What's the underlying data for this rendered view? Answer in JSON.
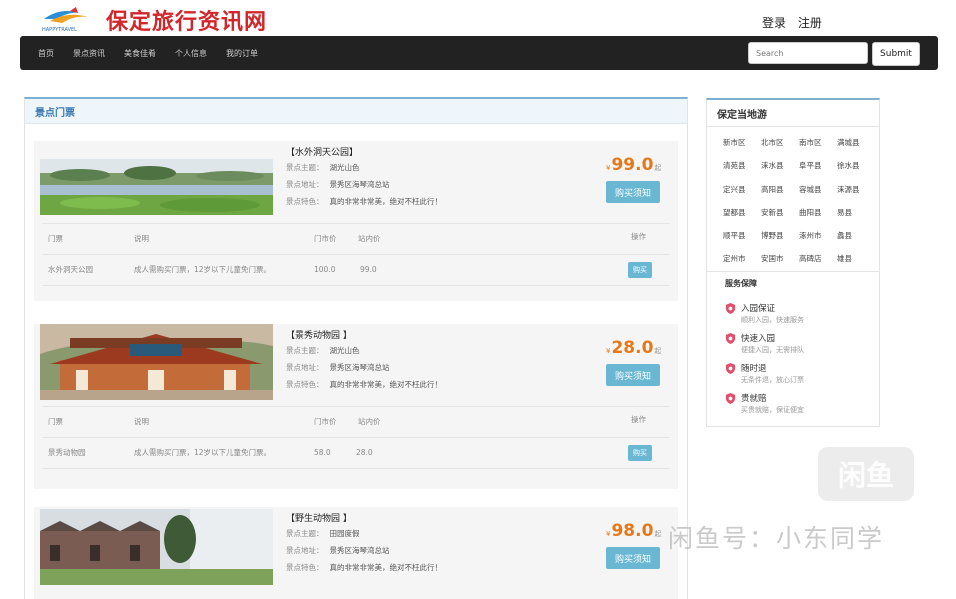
{
  "brand": {
    "logo_caption": "HAPPYTRAVEL",
    "site_name": "保定旅行资讯网"
  },
  "auth": {
    "login": "登录",
    "register": "注册"
  },
  "nav": {
    "items": [
      "首页",
      "景点资讯",
      "美食佳肴",
      "个人信息",
      "我的订单"
    ],
    "search_placeholder": "Search",
    "submit_label": "Submit"
  },
  "main": {
    "title": "景点门票",
    "labels": {
      "theme": "景点主题：",
      "address": "景点地址：",
      "feature": "景点特色：",
      "buy_notice": "购买须知",
      "price_unit": "¥",
      "price_suffix": "起"
    },
    "table_headers": {
      "ticket": "门票",
      "desc": "说明",
      "market_price": "门市价",
      "site_price": "站内价",
      "action": "操作"
    },
    "attractions": [
      {
        "name": "【水外洞天公园】",
        "theme": "湖光山色",
        "address": "景秀区海琴湾总站",
        "feature": "真的非常非常美，绝对不枉此行！",
        "price": "99.0",
        "ticket_name": "水外洞天公园",
        "ticket_desc": "成人需购买门票，12岁以下儿童免门票。",
        "market_price": "100.0",
        "site_price": "99.0",
        "buy_label": "购买"
      },
      {
        "name": "【景秀动物园 】",
        "theme": "湖光山色",
        "address": "景秀区海琴湾总站",
        "feature": "真的非常非常美，绝对不枉此行！",
        "price": "28.0",
        "ticket_name": "景秀动物园",
        "ticket_desc": "成人需购买门票，12岁以下儿童免门票。",
        "market_price": "58.0",
        "site_price": "28.0",
        "buy_label": "购买"
      },
      {
        "name": "【野生动物园 】",
        "theme": "田园度假",
        "address": "景秀区海琴湾总站",
        "feature": "真的非常非常美，绝对不枉此行！",
        "price": "98.0"
      }
    ]
  },
  "sidebar": {
    "title": "保定当地游",
    "counties": [
      "新市区",
      "北市区",
      "南市区",
      "满城县",
      "清苑县",
      "涞水县",
      "阜平县",
      "徐水县",
      "定兴县",
      "高阳县",
      "容城县",
      "涞源县",
      "望都县",
      "安新县",
      "曲阳县",
      "易县",
      "顺平县",
      "博野县",
      "涿州市",
      "蠡县",
      "定州市",
      "安国市",
      "高碑店",
      "雄县"
    ],
    "service_title": "服务保障",
    "services": [
      {
        "title": "入园保证",
        "sub": "顺利入园，快速服务"
      },
      {
        "title": "快速入园",
        "sub": "便捷入园，无需排队"
      },
      {
        "title": "随时退",
        "sub": "无条件退，放心订票"
      },
      {
        "title": "贵就赔",
        "sub": "买贵就赔，保证便宜"
      }
    ]
  },
  "watermark": {
    "badge": "闲鱼",
    "text": "闲鱼号：小东同学"
  },
  "colors": {
    "accent": "#6ab7d3",
    "price": "#e77817",
    "navbar": "#222222",
    "logo_red": "#d3262b"
  }
}
